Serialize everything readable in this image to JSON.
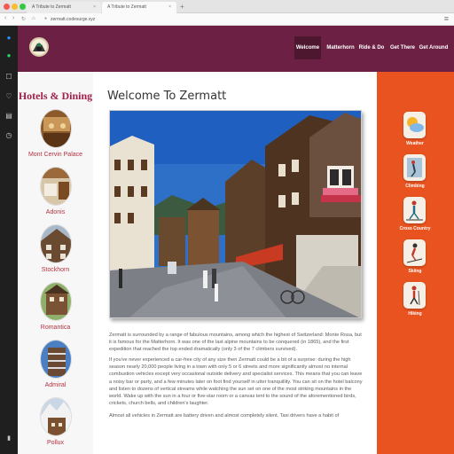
{
  "browser": {
    "tabs": [
      {
        "label": "A Tribute to Zermatt"
      },
      {
        "label": "A Tribute to Zermatt"
      }
    ],
    "url": "zermatt.codesurge.xyz"
  },
  "site": {
    "nav": [
      {
        "label": "Welcome"
      },
      {
        "label": "Matterhorn"
      },
      {
        "label": "Ride & Do"
      },
      {
        "label": "Get There"
      },
      {
        "label": "Get Around"
      }
    ]
  },
  "left": {
    "title": "Hotels & Dining",
    "hotels": [
      {
        "name": "Mont Cervin Palace"
      },
      {
        "name": "Adonis"
      },
      {
        "name": "Stockhorn"
      },
      {
        "name": "Romantica"
      },
      {
        "name": "Admiral"
      },
      {
        "name": "Pollux"
      }
    ]
  },
  "main": {
    "title": "Welcome To Zermatt",
    "paragraphs": [
      "Zermatt is surrounded by a range of fabulous mountains, among which the highest of Switzerland: Monte Rosa, but it is famous for the Matterhorn. It was one of the last alpine mountains to be conquered (in 1865), and the first expedition that reached the top ended dramatically (only 3 of the 7 climbers survived).",
      "If you've never experienced a car-free city of any size then Zermatt could be a bit of a surprise: during the high season nearly 20,000 people living in a town with only 5 or 6 streets and more significantly almost no internal combustion vehicles except very occasional outside delivery and specialist services. This means that you can leave a noisy bar or party, and a few minutes later on foot find yourself in utter tranquillity. You can sit on the hotel balcony and listen to dozens of vertical streams while watching the sun set on one of the most striking mountains in the world. Wake up with the sun in a four or five-star room or a canvas tent to the sound of the aforementioned birds, crickets, church bells, and children's laughter.",
      "Almost all vehicles in Zermatt are battery driven and almost completely silent. Taxi drivers have a habit of"
    ]
  },
  "right": {
    "activities": [
      {
        "name": "Weather",
        "icon": "weather-icon"
      },
      {
        "name": "Climbing",
        "icon": "climbing-icon"
      },
      {
        "name": "Cross Country",
        "icon": "cross-country-icon"
      },
      {
        "name": "Skiing",
        "icon": "skiing-icon"
      },
      {
        "name": "Hiking",
        "icon": "hiking-icon"
      }
    ]
  },
  "colors": {
    "header": "#6c2144",
    "active_nav": "#4e1730",
    "accent_text": "#a3204a",
    "right_column": "#e8531f"
  }
}
